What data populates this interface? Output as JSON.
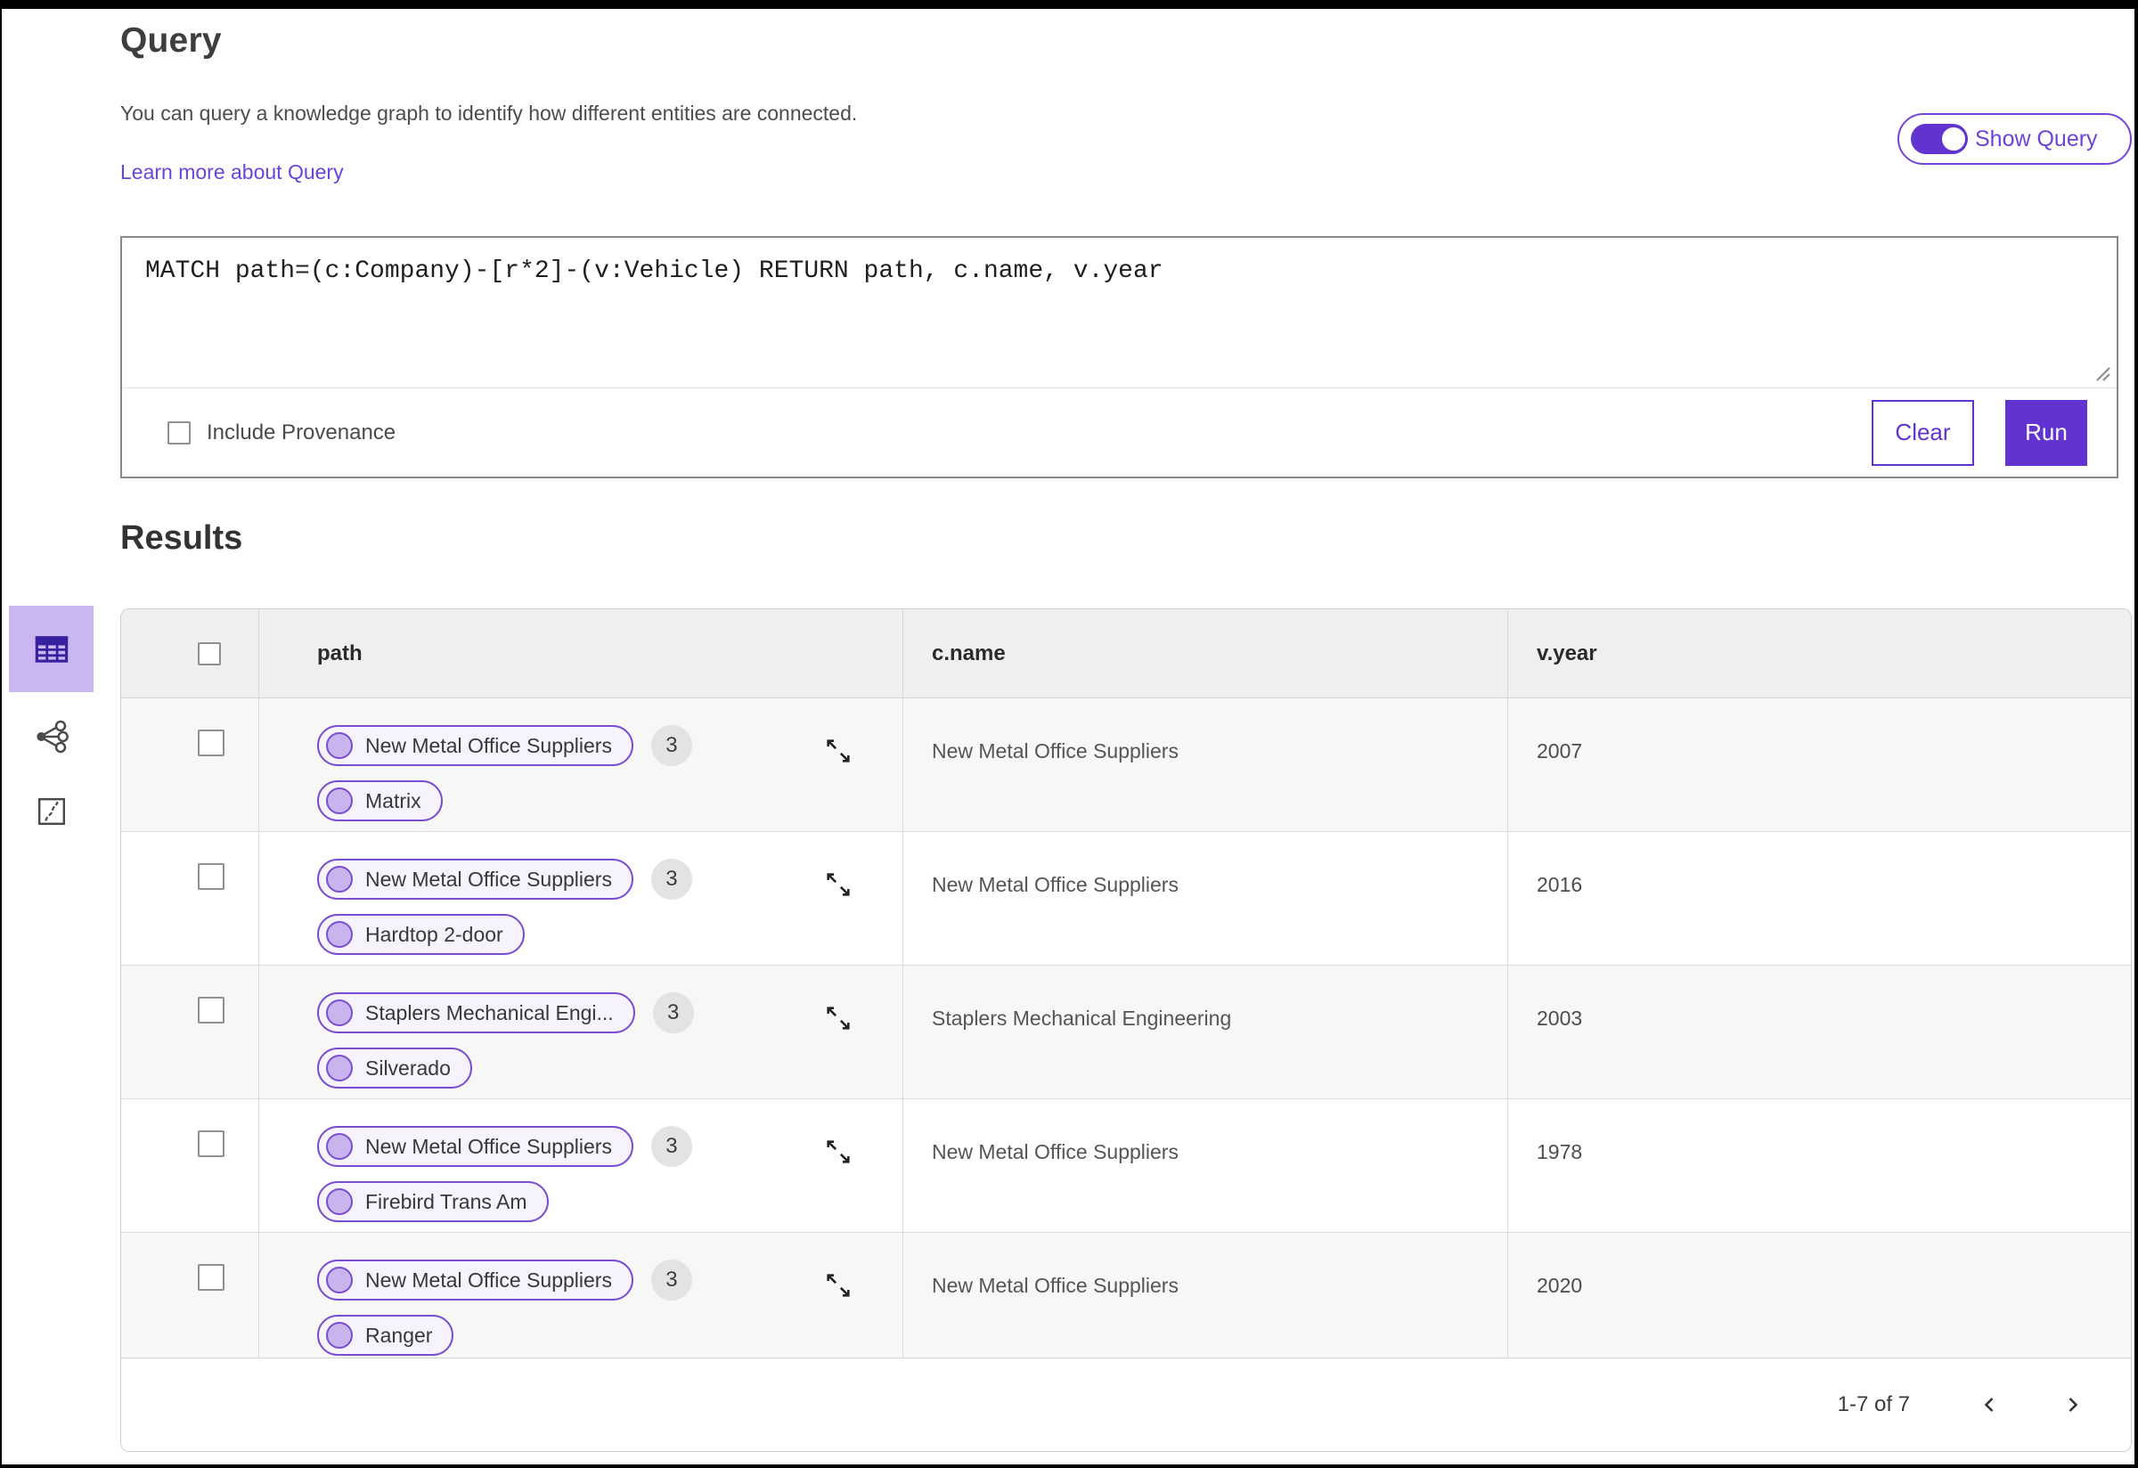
{
  "page": {
    "title": "Query",
    "description": "You can query a knowledge graph to identify how different entities are connected.",
    "learn_more": "Learn more about Query",
    "show_query_label": "Show Query",
    "results_title": "Results"
  },
  "query_editor": {
    "text": "MATCH path=(c:Company)-[r*2]-(v:Vehicle) RETURN path, c.name, v.year",
    "include_provenance_label": "Include Provenance",
    "clear_label": "Clear",
    "run_label": "Run"
  },
  "sidebar": {
    "items": [
      {
        "icon": "table-icon",
        "selected": true
      },
      {
        "icon": "graph-icon",
        "selected": false
      },
      {
        "icon": "sketch-icon",
        "selected": false
      }
    ]
  },
  "results_table": {
    "columns": [
      "path",
      "c.name",
      "v.year"
    ],
    "rows": [
      {
        "path_primary": "New Metal Office Suppliers",
        "path_count": "3",
        "path_secondary": "Matrix",
        "c_name": "New Metal Office Suppliers",
        "v_year": "2007"
      },
      {
        "path_primary": "New Metal Office Suppliers",
        "path_count": "3",
        "path_secondary": "Hardtop 2-door",
        "c_name": "New Metal Office Suppliers",
        "v_year": "2016"
      },
      {
        "path_primary": "Staplers Mechanical Engi...",
        "path_count": "3",
        "path_secondary": "Silverado",
        "c_name": "Staplers Mechanical Engineering",
        "v_year": "2003"
      },
      {
        "path_primary": "New Metal Office Suppliers",
        "path_count": "3",
        "path_secondary": "Firebird Trans Am",
        "c_name": "New Metal Office Suppliers",
        "v_year": "1978"
      },
      {
        "path_primary": "New Metal Office Suppliers",
        "path_count": "3",
        "path_secondary": "Ranger",
        "c_name": "New Metal Office Suppliers",
        "v_year": "2020"
      }
    ],
    "pagination": "1-7 of 7"
  },
  "colors": {
    "accent": "#6134d1",
    "pill_border": "#7a4ed2",
    "pill_fill": "#f6f3fd",
    "node_fill": "#c9b4ee",
    "selected_view_bg": "#cbb7f0",
    "link": "#6a43dc"
  }
}
